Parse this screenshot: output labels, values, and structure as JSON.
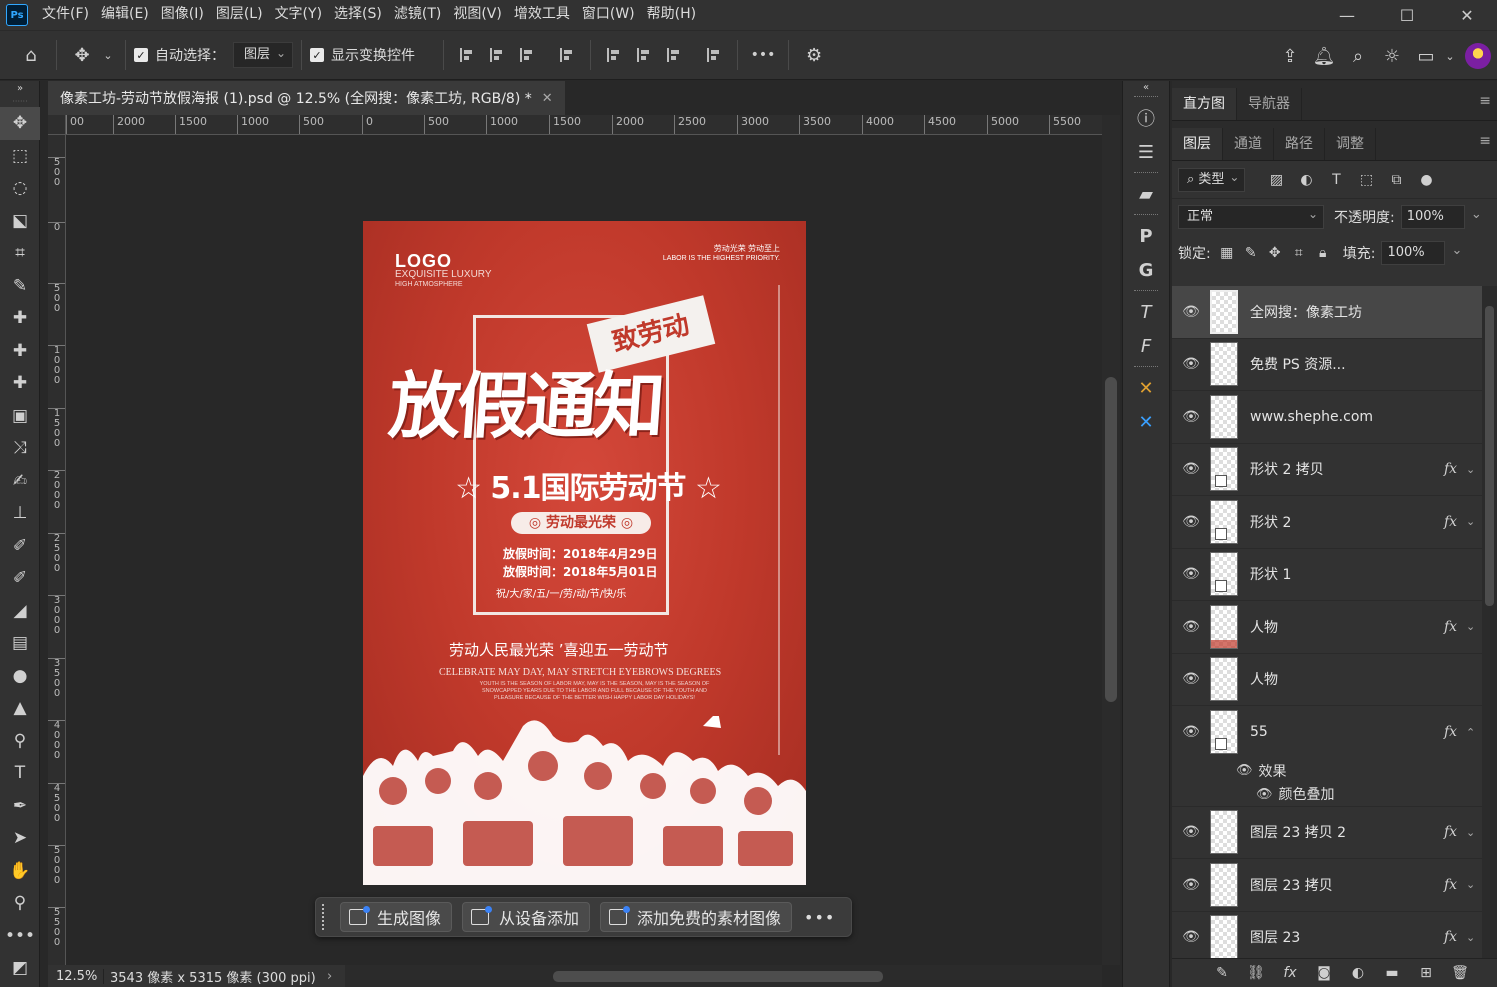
{
  "menubar": {
    "logo": "Ps",
    "items": [
      "文件(F)",
      "编辑(E)",
      "图像(I)",
      "图层(L)",
      "文字(Y)",
      "选择(S)",
      "滤镜(T)",
      "视图(V)",
      "增效工具",
      "窗口(W)",
      "帮助(H)"
    ],
    "window_controls": [
      "—",
      "☐",
      "✕"
    ]
  },
  "options": {
    "auto_select_label": "自动选择：",
    "auto_select_value": "图层",
    "show_transform_label": "显示变换控件",
    "more": "•••"
  },
  "document": {
    "tab_title": "像素工坊-劳动节放假海报 (1).psd @ 12.5% (全网搜：像素工坊, RGB/8) *",
    "tab_close": "✕"
  },
  "ruler": {
    "h_labels": [
      "00",
      "2000",
      "1500",
      "1000",
      "500",
      "0",
      "500",
      "1000",
      "1500",
      "2000",
      "2500",
      "3000",
      "3500",
      "4000",
      "4500",
      "5000",
      "5500"
    ],
    "v_labels": [
      "500",
      "0",
      "500",
      "1000",
      "1500",
      "2000",
      "2500",
      "3000",
      "3500",
      "4000",
      "4500",
      "5000",
      "5500"
    ]
  },
  "poster": {
    "logo": "LOGO",
    "logo_sub1": "EXQUISITE LUXURY",
    "logo_sub2": "HIGH ATMOSPHERE",
    "top_right_1": "劳动光荣 劳动至上",
    "top_right_2": "LABOR IS THE HIGHEST PRIORITY.",
    "badge": "致劳动",
    "main_title": "放假通知",
    "subtitle": "☆ 5.1国际劳动节 ☆",
    "pill": "◎ 劳动最光荣 ◎",
    "date1": "放假时间：2018年4月29日",
    "date2": "放假时间：2018年5月01日",
    "wish": "祝/大/家/五/一/劳/动/节/快/乐",
    "cn_line": "劳动人民最光荣 ’喜迎五一劳动节",
    "en_title": "CELEBRATE MAY DAY, MAY STRETCH EYEBROWS DEGREES",
    "en_small": "YOUTH IS THE SEASON OF LABOR MAY, MAY IS THE SEASON, MAY IS THE SEASON OF SNOWCAPPED YEARS DUE TO THE LABOR AND FULL BECAUSE OF THE YOUTH AND PLEASURE BECAUSE OF THE BETTER WISH HAPPY LABOR DAY HOLIDAYS!"
  },
  "statusbar": {
    "zoom": "12.5%",
    "info": "3543 像素 x 5315 像素 (300 ppi)",
    "arrow": "›"
  },
  "ctxbar": {
    "buttons": [
      "生成图像",
      "从设备添加",
      "添加免费的素材图像"
    ],
    "more": "•••"
  },
  "panels": {
    "top_tabs": [
      "直方图",
      "导航器"
    ],
    "layer_tabs": [
      "图层",
      "通道",
      "路径",
      "调整"
    ],
    "filter_kind": "类型",
    "blend_mode": "正常",
    "opacity_label": "不透明度:",
    "opacity_value": "100%",
    "lock_label": "锁定:",
    "fill_label": "填充:",
    "fill_value": "100%"
  },
  "layers": [
    {
      "name": "全网搜：像素工坊",
      "fx": "",
      "selected": true,
      "thumb": "plain"
    },
    {
      "name": "免费 PS 资源...",
      "fx": "",
      "selected": false,
      "thumb": "plain"
    },
    {
      "name": "www.shephe.com",
      "fx": "",
      "selected": false,
      "thumb": "plain"
    },
    {
      "name": "形状 2 拷贝",
      "fx": "fx",
      "selected": false,
      "thumb": "shape"
    },
    {
      "name": "形状 2",
      "fx": "fx",
      "selected": false,
      "thumb": "shape"
    },
    {
      "name": "形状 1",
      "fx": "",
      "selected": false,
      "thumb": "shape"
    },
    {
      "name": "人物",
      "fx": "fx",
      "selected": false,
      "thumb": "red"
    },
    {
      "name": "人物",
      "fx": "",
      "selected": false,
      "thumb": "plain"
    },
    {
      "name": "55",
      "fx": "fx",
      "selected": false,
      "thumb": "shape"
    }
  ],
  "layer_effects": {
    "label": "效果",
    "item": "颜色叠加"
  },
  "layers_after": [
    {
      "name": "图层 23 拷贝 2",
      "fx": "fx"
    },
    {
      "name": "图层 23 拷贝",
      "fx": "fx"
    },
    {
      "name": "图层 23",
      "fx": "fx"
    }
  ]
}
